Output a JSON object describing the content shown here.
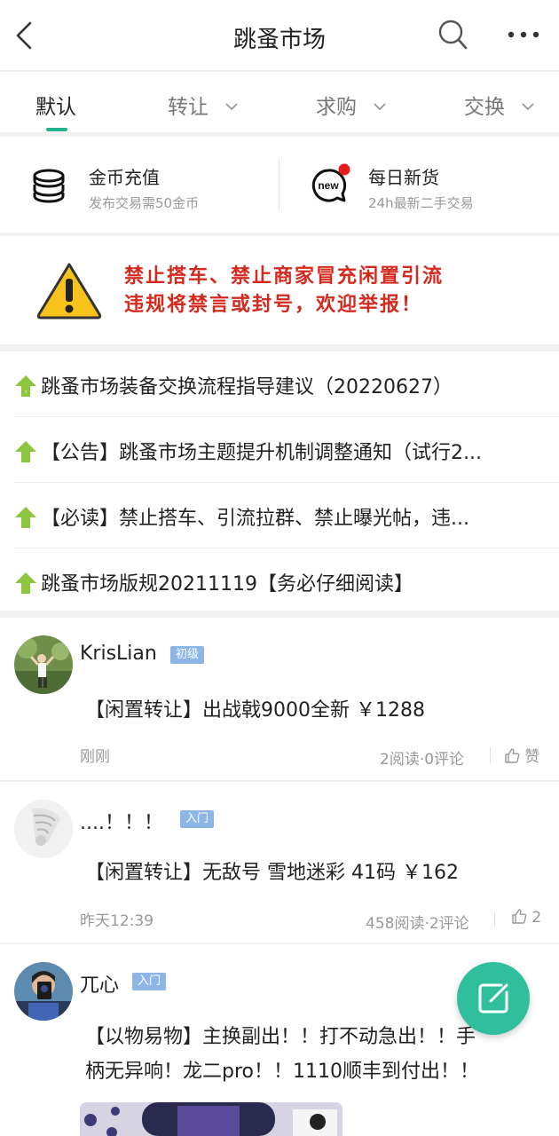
{
  "header": {
    "title": "跳蚤市场"
  },
  "tabs": [
    {
      "label": "默认"
    },
    {
      "label": "转让"
    },
    {
      "label": "求购"
    },
    {
      "label": "交换"
    }
  ],
  "services": [
    {
      "title": "金币充值",
      "subtitle": "发布交易需50金币",
      "icon": "coins-icon"
    },
    {
      "title": "每日新货",
      "subtitle": "24h最新二手交易",
      "icon": "new-badge-icon",
      "icon_text": "new"
    }
  ],
  "warning": {
    "line1": "禁止搭车、禁止商家冒充闲置引流",
    "line2": "违规将禁言或封号，欢迎举报！"
  },
  "pinned": [
    {
      "text": "跳蚤市场装备交换流程指导建议（20220627）"
    },
    {
      "text": "【公告】跳蚤市场主题提升机制调整通知（试行2..."
    },
    {
      "text": "【必读】禁止搭车、引流拉群、禁止曝光帖，违..."
    },
    {
      "text": "跳蚤市场版规20211119【务必仔细阅读】"
    }
  ],
  "posts": [
    {
      "user": "KrisLian",
      "badge": "初级",
      "title": "【闲置转让】出战戟9000全新 ￥1288",
      "time": "刚刚",
      "stats": "2阅读·0评论",
      "like": "赞"
    },
    {
      "user": "....！！！",
      "badge": "入门",
      "title": "【闲置转让】无敌号 雪地迷彩 41码 ￥162",
      "time": "昨天12:39",
      "stats": "458阅读·2评论",
      "like": "2"
    },
    {
      "user": "兀心",
      "badge": "入门",
      "title_line1": "【以物易物】主换副出！！打不动急出！！手",
      "title_line2": "柄无异响！龙二pro！！1110顺丰到付出！！"
    }
  ],
  "colors": {
    "accent": "#23b38f",
    "warning_red": "#d42a1e",
    "badge_blue": "#8db5e6",
    "fab": "#2fbf9c",
    "pin_green": "#8cc63f"
  }
}
